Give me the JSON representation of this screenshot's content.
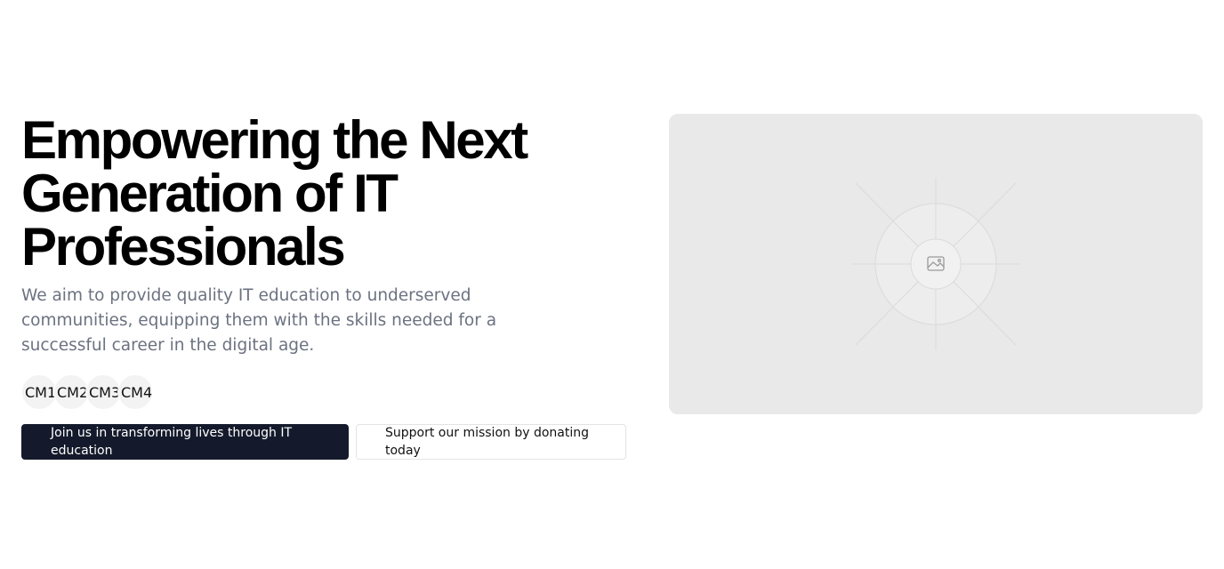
{
  "hero": {
    "headline_line1": "Empowering the Next",
    "headline_line2": "Generation of IT",
    "headline_line3": "Professionals",
    "description": "We aim to provide quality IT education to underserved communities, equipping them with the skills needed for a successful career in the digital age.",
    "avatars": [
      "CM1",
      "CM2",
      "CM3",
      "CM4"
    ],
    "primary_button": "Join us in transforming lives through IT education",
    "secondary_button": "Support our mission by donating today",
    "image_icon": "image-placeholder-icon"
  },
  "colors": {
    "primary_button_bg": "#141a2b",
    "text_muted": "#6b7280",
    "placeholder_bg": "#e9e9e9"
  }
}
